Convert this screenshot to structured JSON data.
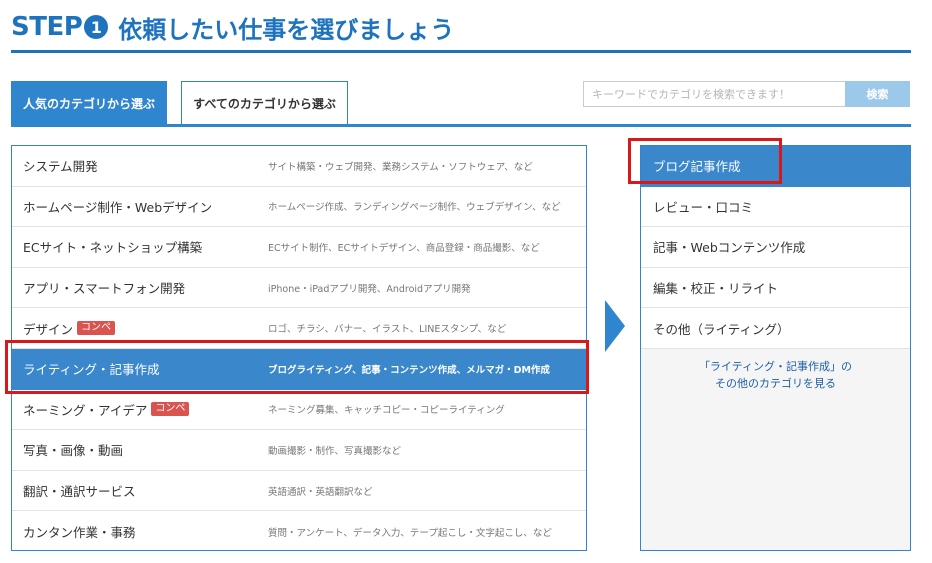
{
  "header": {
    "step_word": "STEP",
    "step_number": "1",
    "title": "依頼したい仕事を選びましょう"
  },
  "tabs": [
    {
      "label": "人気のカテゴリから選ぶ",
      "active": true
    },
    {
      "label": "すべてのカテゴリから選ぶ",
      "active": false
    }
  ],
  "search": {
    "placeholder": "キーワードでカテゴリを検索できます！",
    "value": "",
    "button_label": "検索"
  },
  "categories": [
    {
      "name": "システム開発",
      "badge": "",
      "desc": "サイト構築・ウェブ開発、業務システム・ソフトウェア、など"
    },
    {
      "name": "ホームページ制作・Webデザイン",
      "badge": "",
      "desc": "ホームページ作成、ランディングページ制作、ウェブデザイン、など"
    },
    {
      "name": "ECサイト・ネットショップ構築",
      "badge": "",
      "desc": "ECサイト制作、ECサイトデザイン、商品登録・商品撮影、など"
    },
    {
      "name": "アプリ・スマートフォン開発",
      "badge": "",
      "desc": "iPhone・iPadアプリ開発、Androidアプリ開発"
    },
    {
      "name": "デザイン",
      "badge": "コンペ",
      "desc": "ロゴ、チラシ、バナー、イラスト、LINEスタンプ、など"
    },
    {
      "name": "ライティング・記事作成",
      "badge": "",
      "desc": "ブログライティング、記事・コンテンツ作成、メルマガ・DM作成",
      "selected": true
    },
    {
      "name": "ネーミング・アイデア",
      "badge": "コンペ",
      "desc": "ネーミング募集、キャッチコピー・コピーライティング"
    },
    {
      "name": "写真・画像・動画",
      "badge": "",
      "desc": "動画撮影・制作、写真撮影など"
    },
    {
      "name": "翻訳・通訳サービス",
      "badge": "",
      "desc": "英語通訳・英語翻訳など"
    },
    {
      "name": "カンタン作業・事務",
      "badge": "",
      "desc": "質問・アンケート、データ入力、テープ起こし・文字起こし、など"
    }
  ],
  "subcategories": [
    {
      "label": "ブログ記事作成",
      "selected": true
    },
    {
      "label": "レビュー・口コミ",
      "selected": false
    },
    {
      "label": "記事・Webコンテンツ作成",
      "selected": false
    },
    {
      "label": "編集・校正・リライト",
      "selected": false
    },
    {
      "label": "その他（ライティング）",
      "selected": false
    }
  ],
  "sub_more": {
    "line1": "「ライティング・記事作成」の",
    "line2": "その他のカテゴリを見る"
  },
  "colors": {
    "brand_blue": "#1e73be",
    "selected_blue": "#3a87cb",
    "highlight_red": "#d8191c",
    "badge_red": "#d9534f"
  }
}
